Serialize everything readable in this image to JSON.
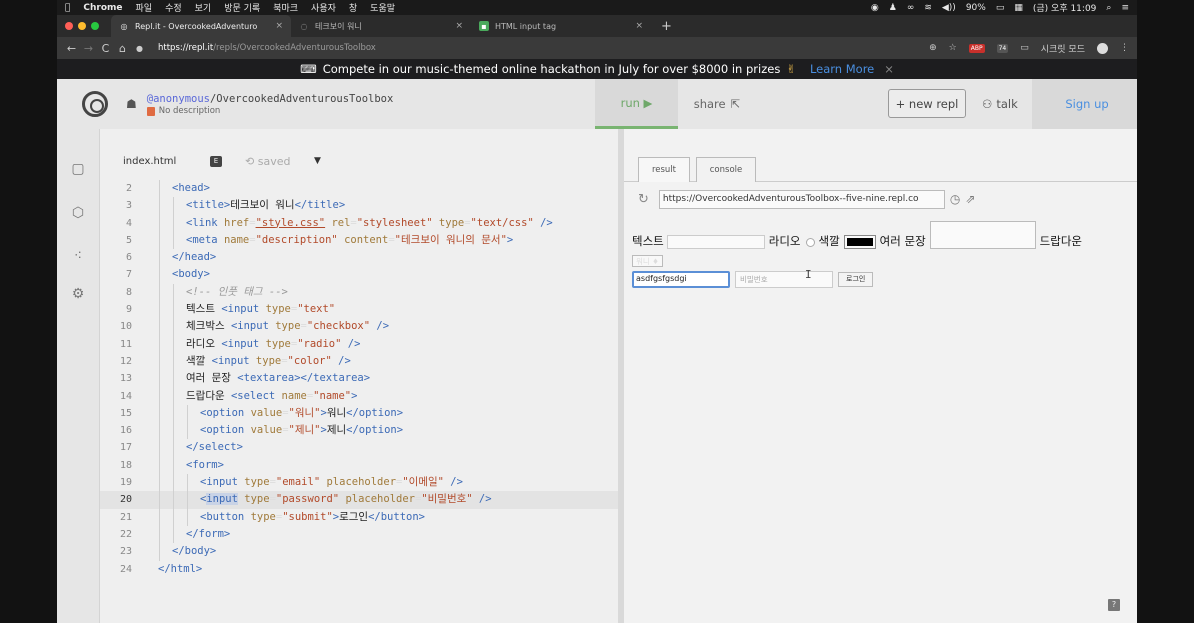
{
  "menubar": {
    "app": "Chrome",
    "items": [
      "파일",
      "수정",
      "보기",
      "방문 기록",
      "북마크",
      "사용자",
      "창",
      "도움말"
    ],
    "battery": "90%",
    "clock": "(금) 오후 11:09"
  },
  "tabs": [
    {
      "title": "Repl.it - OvercookedAdventuro",
      "active": true
    },
    {
      "title": "테크보이 워니",
      "active": false
    },
    {
      "title": "HTML input tag",
      "active": false
    }
  ],
  "address": {
    "host": "https://repl.it",
    "path": "/repls/OvercookedAdventurousToolbox",
    "badge": "74",
    "incognito": "시크릿 모드"
  },
  "announcement": {
    "text": "Compete in our music-themed online hackathon in July for over $8000 in prizes",
    "link": "Learn More",
    "close": "×"
  },
  "repl": {
    "user": "@anonymous",
    "name": "/OvercookedAdventurousToolbox",
    "description": "No description",
    "run_label": "run ▶",
    "share_label": "share",
    "new_repl_label": "+ new repl",
    "talk_label": "talk",
    "signup_label": "Sign up"
  },
  "editor": {
    "filename": "index.html",
    "saved": "saved",
    "menu": "▼"
  },
  "result": {
    "tab_result": "result",
    "tab_console": "console",
    "url": "https://OvercookedAdventurousToolbox--five-nine.repl.co",
    "labels": {
      "text": "텍스트",
      "radio": "라디오",
      "color": "색깔",
      "textarea": "여러 문장",
      "dropdown": "드랍다운"
    },
    "select_value": "워니 ♦",
    "email_value": "asdfgsfgsdgi",
    "password_placeholder": "비밀번호",
    "submit_label": "로그인",
    "help": "?"
  }
}
